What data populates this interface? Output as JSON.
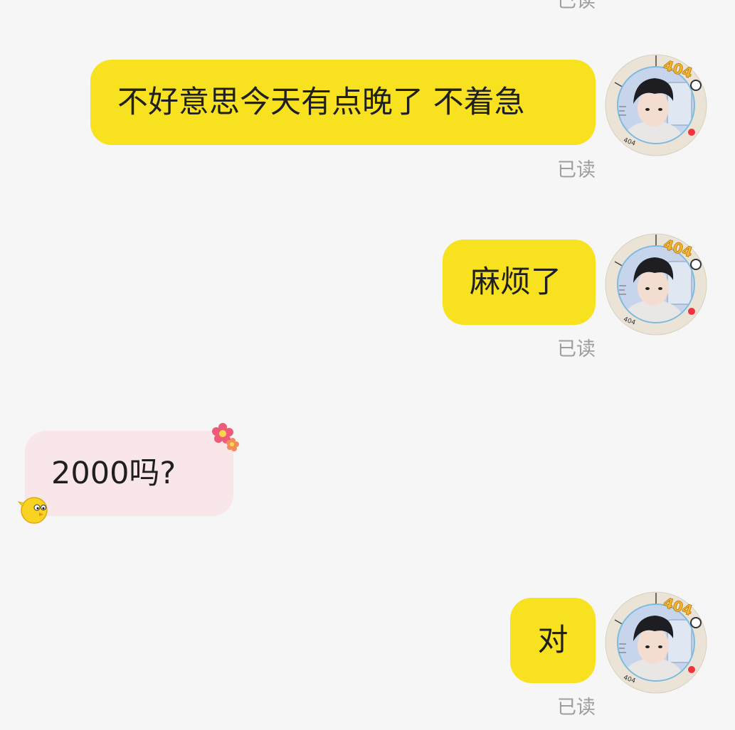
{
  "chat": {
    "top_read_label": "已读",
    "messages": [
      {
        "direction": "outgoing",
        "text": "不好意思今天有点晚了 不着急",
        "status": "已读",
        "avatar_badge": "404"
      },
      {
        "direction": "outgoing",
        "text": "麻烦了",
        "status": "已读",
        "avatar_badge": "404"
      },
      {
        "direction": "incoming",
        "text": "2000吗?"
      },
      {
        "direction": "outgoing",
        "text": "对",
        "status": "已读",
        "avatar_badge": "404"
      }
    ]
  },
  "colors": {
    "background": "#f6f6f6",
    "outgoing_bubble": "#f8e11f",
    "incoming_bubble": "#f8e6e8",
    "read_status": "#9e9e9e"
  },
  "icons": {
    "avatar": "user-avatar-with-404-frame",
    "sticker_flower": "flower-sticker-icon",
    "sticker_chick": "chick-sticker-icon"
  }
}
